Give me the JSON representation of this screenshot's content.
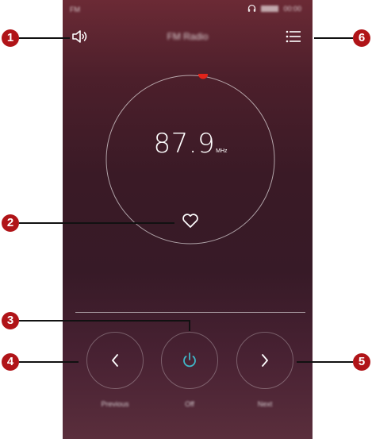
{
  "status_bar": {
    "left_text": "FM",
    "right_text": "00:00"
  },
  "toolbar": {
    "title": "FM Radio",
    "speaker_icon": "speaker-icon",
    "menu_icon": "list-menu-icon"
  },
  "dial": {
    "frequency": "87.9",
    "unit": "MHz",
    "marker_color": "#e2231a",
    "favorite_icon": "heart-outline-icon"
  },
  "controls": {
    "previous_label": "Previous",
    "power_label": "Off",
    "next_label": "Next",
    "power_color": "#3fb6c8"
  },
  "callouts": [
    {
      "number": "1"
    },
    {
      "number": "2"
    },
    {
      "number": "3"
    },
    {
      "number": "4"
    },
    {
      "number": "5"
    },
    {
      "number": "6"
    }
  ],
  "colors": {
    "callout_badge": "#b01418",
    "background_top": "#6b2a35",
    "background_mid": "#371a27"
  }
}
